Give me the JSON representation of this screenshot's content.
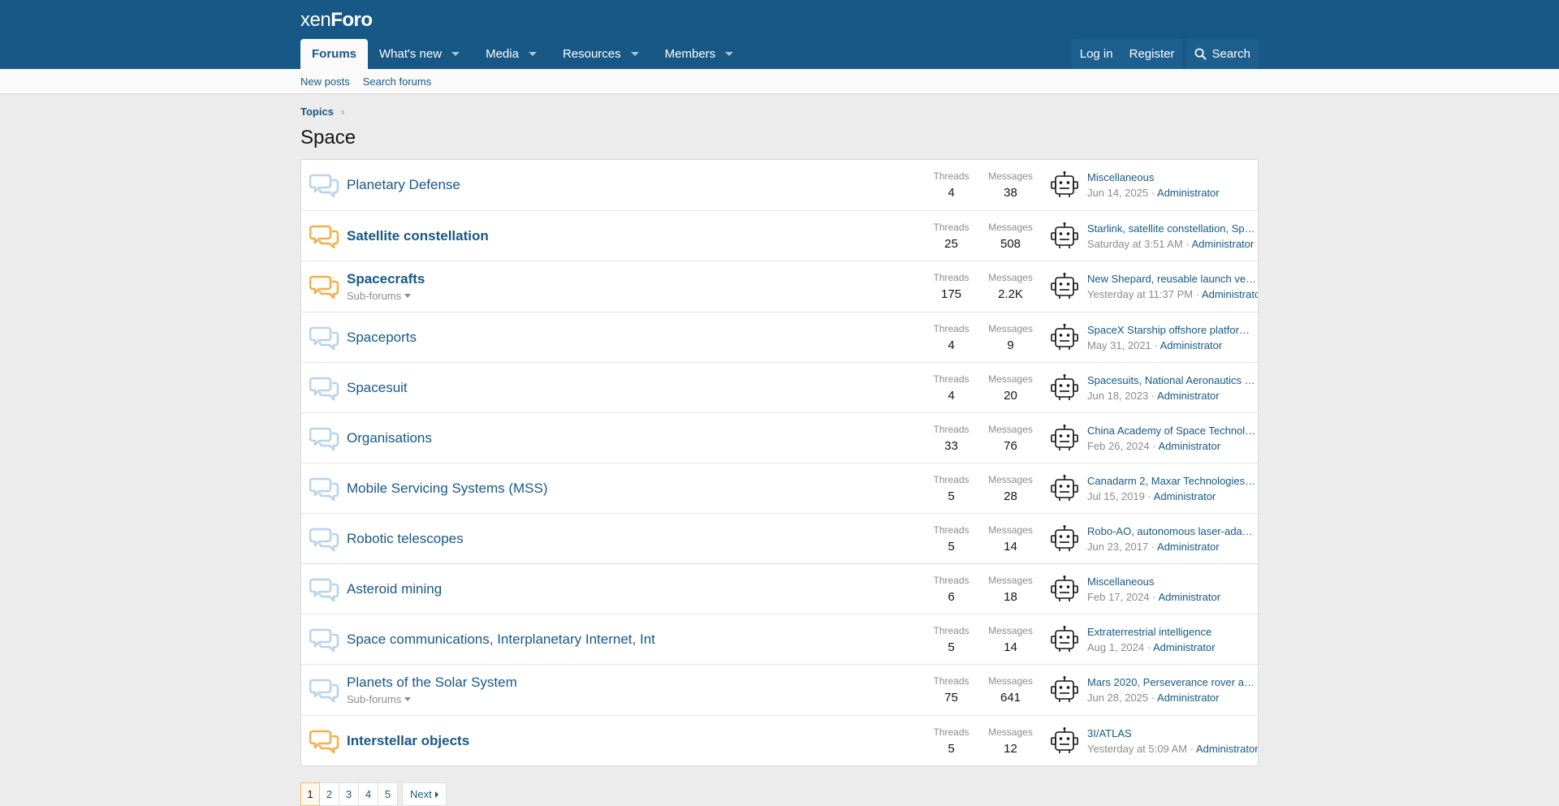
{
  "header": {
    "logo_part1": "xen",
    "logo_part2": "Foro",
    "nav": [
      {
        "label": "Forums",
        "active": true,
        "caret": false
      },
      {
        "label": "What's new",
        "active": false,
        "caret": true
      },
      {
        "label": "Media",
        "active": false,
        "caret": true
      },
      {
        "label": "Resources",
        "active": false,
        "caret": true
      },
      {
        "label": "Members",
        "active": false,
        "caret": true
      }
    ],
    "login_label": "Log in",
    "register_label": "Register",
    "search_label": "Search"
  },
  "subnav": {
    "new_posts": "New posts",
    "search_forums": "Search forums"
  },
  "breadcrumb": {
    "topics": "Topics",
    "separator": "›"
  },
  "page_title": "Space",
  "stat_labels": {
    "threads": "Threads",
    "messages": "Messages"
  },
  "forums": [
    {
      "title": "Planetary Defense",
      "unread": false,
      "subforums": "",
      "threads": "4",
      "messages": "38",
      "last_title": "Miscellaneous",
      "last_date": "Jun 14, 2025",
      "last_user": "Administrator"
    },
    {
      "title": "Satellite constellation",
      "unread": true,
      "subforums": "",
      "threads": "25",
      "messages": "508",
      "last_title": "Starlink, satellite constellation, Spa…",
      "last_date": "Saturday at 3:51 AM",
      "last_user": "Administrator"
    },
    {
      "title": "Spacecrafts",
      "unread": true,
      "subforums": "Sub-forums",
      "threads": "175",
      "messages": "2.2K",
      "last_title": "New Shepard, reusable launch ve…",
      "last_date": "Yesterday at 11:37 PM",
      "last_user": "Administrato"
    },
    {
      "title": "Spaceports",
      "unread": false,
      "subforums": "",
      "threads": "4",
      "messages": "9",
      "last_title": "SpaceX Starship offshore platform…",
      "last_date": "May 31, 2021",
      "last_user": "Administrator"
    },
    {
      "title": "Spacesuit",
      "unread": false,
      "subforums": "",
      "threads": "4",
      "messages": "20",
      "last_title": "Spacesuits, National Aeronautics a…",
      "last_date": "Jun 18, 2023",
      "last_user": "Administrator"
    },
    {
      "title": "Organisations",
      "unread": false,
      "subforums": "",
      "threads": "33",
      "messages": "76",
      "last_title": "China Academy of Space Technol…",
      "last_date": "Feb 26, 2024",
      "last_user": "Administrator"
    },
    {
      "title": "Mobile Servicing Systems (MSS)",
      "unread": false,
      "subforums": "",
      "threads": "5",
      "messages": "28",
      "last_title": "Canadarm 2, Maxar Technologies …",
      "last_date": "Jul 15, 2019",
      "last_user": "Administrator"
    },
    {
      "title": "Robotic telescopes",
      "unread": false,
      "subforums": "",
      "threads": "5",
      "messages": "14",
      "last_title": "Robo-AO, autonomous laser-adap…",
      "last_date": "Jun 23, 2017",
      "last_user": "Administrator"
    },
    {
      "title": "Asteroid mining",
      "unread": false,
      "subforums": "",
      "threads": "6",
      "messages": "18",
      "last_title": "Miscellaneous",
      "last_date": "Feb 17, 2024",
      "last_user": "Administrator"
    },
    {
      "title": "Space communications, Interplanetary Internet, Int",
      "unread": false,
      "subforums": "",
      "threads": "5",
      "messages": "14",
      "last_title": "Extraterrestrial intelligence",
      "last_date": "Aug 1, 2024",
      "last_user": "Administrator"
    },
    {
      "title": "Planets of the Solar System",
      "unread": false,
      "subforums": "Sub-forums",
      "threads": "75",
      "messages": "641",
      "last_title": "Mars 2020, Perseverance rover an…",
      "last_date": "Jun 28, 2025",
      "last_user": "Administrator"
    },
    {
      "title": "Interstellar objects",
      "unread": true,
      "subforums": "",
      "threads": "5",
      "messages": "12",
      "last_title": "3I/ATLAS",
      "last_date": "Yesterday at 5:09 AM",
      "last_user": "Administrator"
    }
  ],
  "pagination": {
    "pages": [
      "1",
      "2",
      "3",
      "4",
      "5"
    ],
    "current": "1",
    "next_label": "Next"
  },
  "colors": {
    "header_bg": "#185886",
    "link": "#185886",
    "unread_icon": "#f0b04e",
    "read_icon": "#b8d3ea"
  },
  "icons": {
    "forum": "chat-bubbles-icon",
    "avatar": "robot-avatar-icon",
    "search": "search-icon"
  }
}
